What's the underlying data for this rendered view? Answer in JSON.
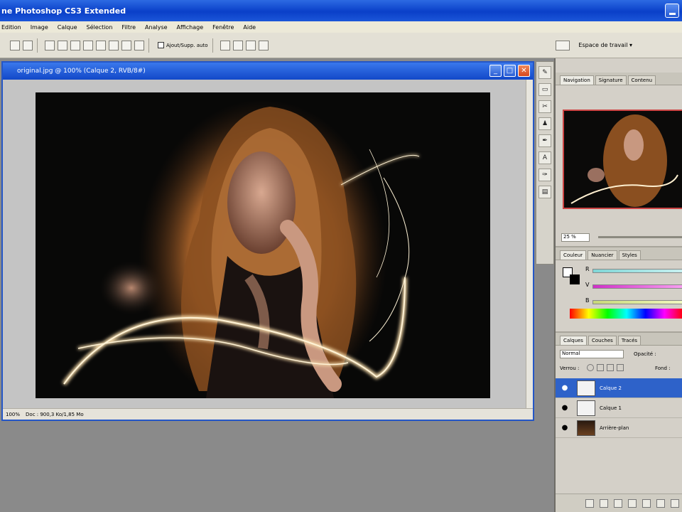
{
  "app": {
    "title": "ne Photoshop CS3 Extended"
  },
  "menu": [
    "Edition",
    "Image",
    "Calque",
    "Sélection",
    "Filtre",
    "Analyse",
    "Affichage",
    "Fenêtre",
    "Aide"
  ],
  "options_bar": {
    "checkbox_label": "Ajout/Supp. auto",
    "workspace_label": "Espace de travail ▾"
  },
  "document": {
    "title": "original.jpg @ 100% (Calque 2, RVB/8#)",
    "zoom": "100%",
    "status": "Doc : 900,3 Ko/1,85 Mo"
  },
  "navigator": {
    "tabs": [
      "Navigation",
      "Signature",
      "Contenu"
    ],
    "zoom": "25 %"
  },
  "color": {
    "tabs": [
      "Couleur",
      "Nuancier",
      "Styles"
    ],
    "channels": [
      "R",
      "V",
      "B"
    ]
  },
  "layers": {
    "tabs": [
      "Calques",
      "Couches",
      "Tracés"
    ],
    "blend_mode": "Normal",
    "opacity_label": "Opacité :",
    "lock_label": "Verrou :",
    "fill_label": "Fond :",
    "items": [
      {
        "name": "Calque 2",
        "selected": true
      },
      {
        "name": "Calque 1",
        "selected": false
      },
      {
        "name": "Arrière-plan",
        "selected": false
      }
    ]
  }
}
